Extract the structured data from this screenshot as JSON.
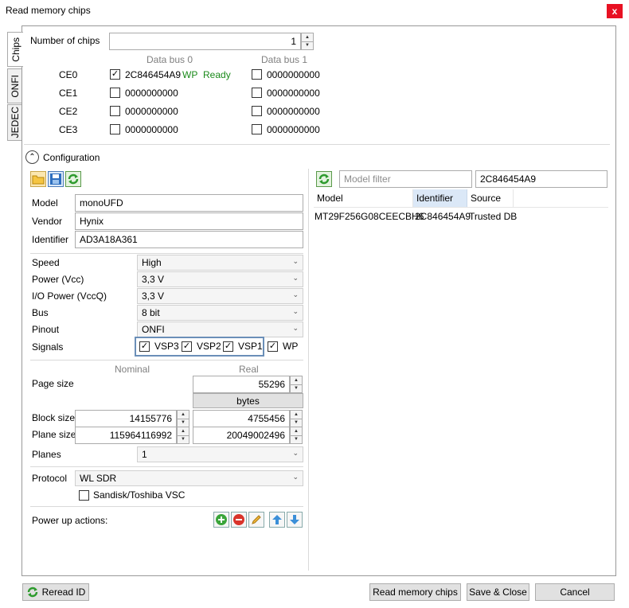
{
  "window": {
    "title": "Read memory chips",
    "close_label": "x"
  },
  "tabs": [
    {
      "label": "Chips"
    },
    {
      "label": "ONFI"
    },
    {
      "label": "JEDEC"
    }
  ],
  "chips": {
    "count_label": "Number of chips",
    "count_value": "1",
    "bus0_header": "Data bus 0",
    "bus1_header": "Data bus 1",
    "rows": [
      {
        "ce": "CE0",
        "bus0_checked": true,
        "bus0_id": "2C846454A9",
        "bus0_wp": "WP",
        "bus0_status": "Ready",
        "bus1_id": "0000000000"
      },
      {
        "ce": "CE1",
        "bus0_checked": false,
        "bus0_id": "0000000000",
        "bus1_id": "0000000000"
      },
      {
        "ce": "CE2",
        "bus0_checked": false,
        "bus0_id": "0000000000",
        "bus1_id": "0000000000"
      },
      {
        "ce": "CE3",
        "bus0_checked": false,
        "bus0_id": "0000000000",
        "bus1_id": "0000000000"
      }
    ]
  },
  "configuration": {
    "header": "Configuration",
    "model_label": "Model",
    "model_value": "monoUFD",
    "vendor_label": "Vendor",
    "vendor_value": "Hynix",
    "identifier_label": "Identifier",
    "identifier_value": "AD3A18A361",
    "speed_label": "Speed",
    "speed_value": "High",
    "power_label": "Power (Vcc)",
    "power_value": "3,3 V",
    "io_power_label": "I/O Power (VccQ)",
    "io_power_value": "3,3 V",
    "bus_label": "Bus",
    "bus_value": "8 bit",
    "pinout_label": "Pinout",
    "pinout_value": "ONFI",
    "signals_label": "Signals",
    "signals": [
      {
        "name": "VSP3",
        "checked": true
      },
      {
        "name": "VSP2",
        "checked": true
      },
      {
        "name": "VSP1",
        "checked": true
      },
      {
        "name": "WP",
        "checked": true
      }
    ],
    "nominal_header": "Nominal",
    "real_header": "Real",
    "page_size_label": "Page size",
    "page_size_real": "55296",
    "bytes_label": "bytes",
    "block_size_label": "Block size",
    "block_size_nominal": "14155776",
    "block_size_real": "4755456",
    "plane_size_label": "Plane size",
    "plane_size_nominal": "115964116992",
    "plane_size_real": "20049002496",
    "planes_label": "Planes",
    "planes_value": "1",
    "protocol_label": "Protocol",
    "protocol_value": "WL SDR",
    "sandisk_label": "Sandisk/Toshiba VSC",
    "sandisk_checked": false,
    "power_up_label": "Power up actions:"
  },
  "model_db": {
    "filter_placeholder": "Model filter",
    "id_filter_value": "2C846454A9",
    "columns": [
      "Model",
      "Identifier",
      "Source"
    ],
    "rows": [
      {
        "model": "MT29F256G08CEECBH6",
        "identifier": "2C846454A9",
        "source": "Trusted DB"
      }
    ]
  },
  "footer": {
    "reread_label": "Reread ID",
    "read_label": "Read memory chips",
    "save_close_label": "Save & Close",
    "cancel_label": "Cancel"
  },
  "colors": {
    "accent_green": "#1a8a1a",
    "close_red": "#e81123",
    "signals_border": "#6b8fb8"
  }
}
